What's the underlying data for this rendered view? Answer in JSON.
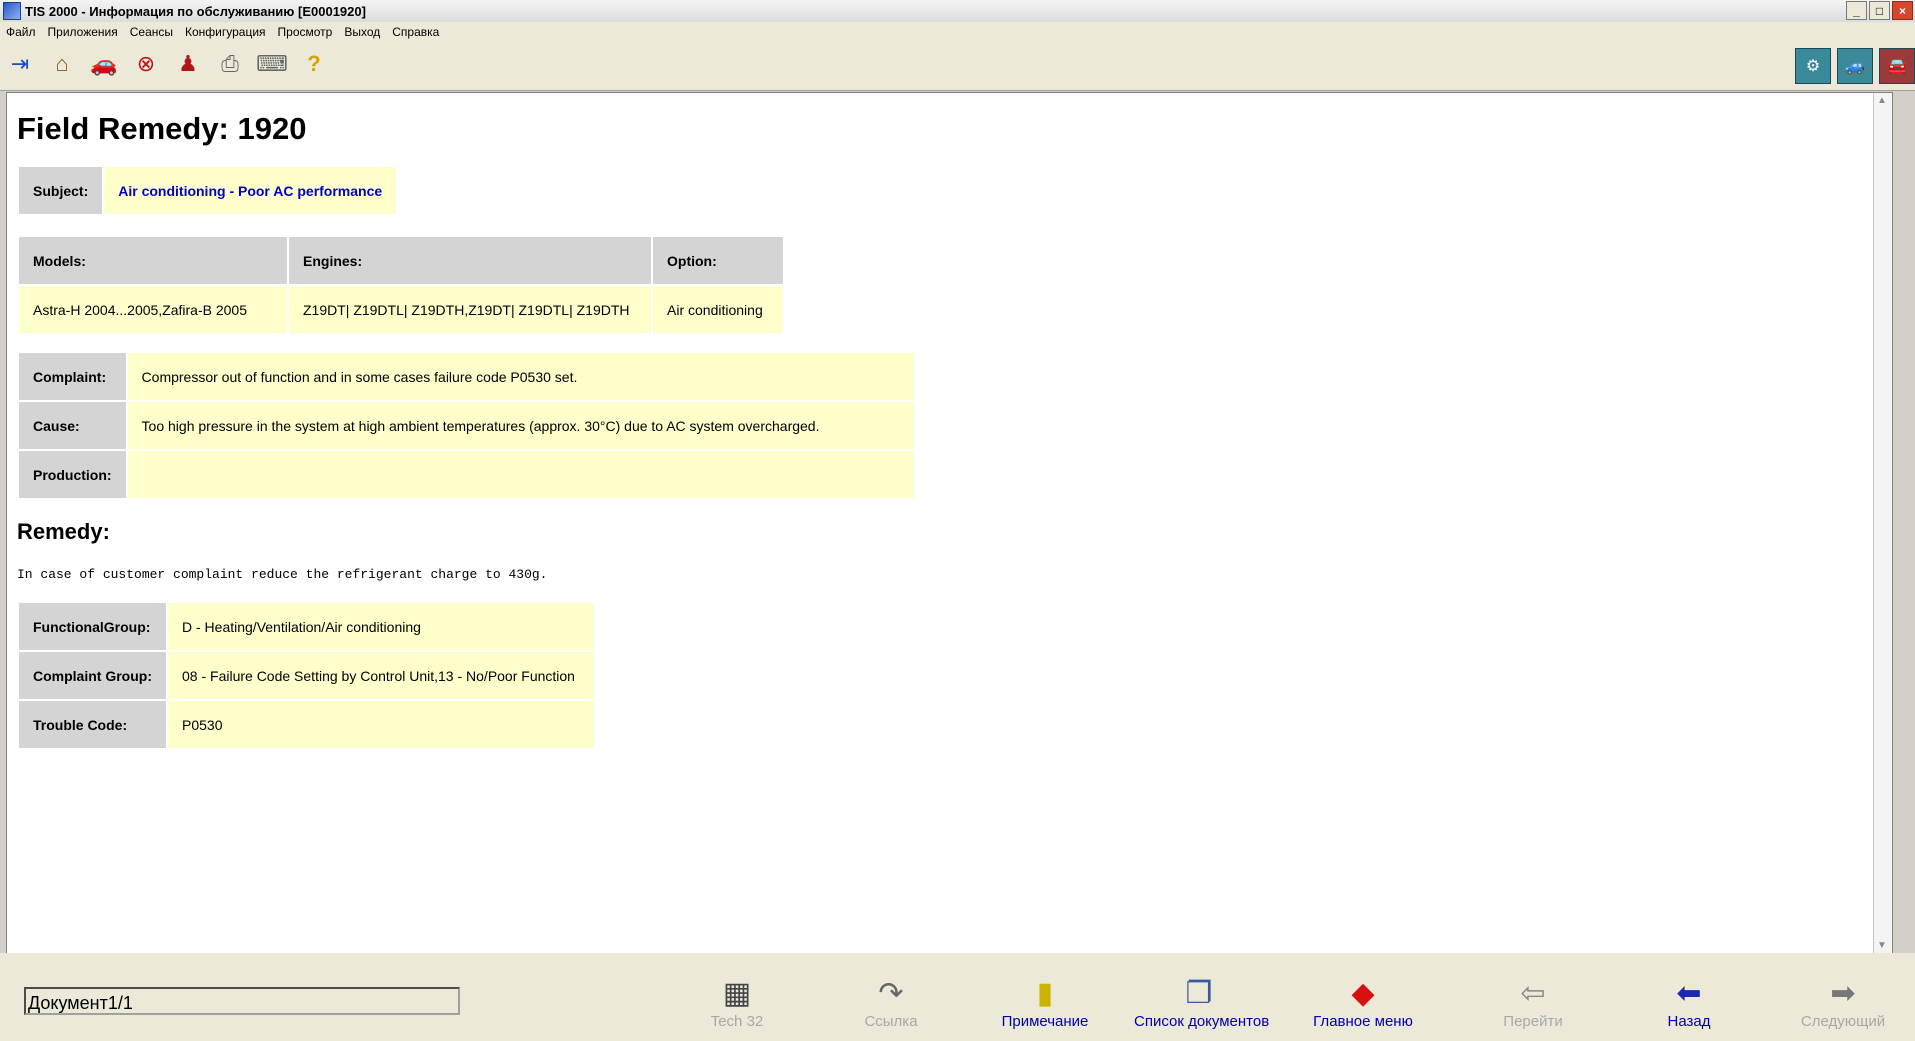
{
  "window": {
    "title": "TIS 2000 - Информация по обслуживанию [E0001920]"
  },
  "menu": [
    "Файл",
    "Приложения",
    "Сеансы",
    "Конфигурация",
    "Просмотр",
    "Выход",
    "Справка"
  ],
  "toolbar_icons": [
    "exit-icon",
    "home-icon",
    "vehicle-icon",
    "stop-icon",
    "person-icon",
    "print-icon",
    "keyboard-icon",
    "help-icon"
  ],
  "toolbar_right_icons": [
    "tools-icon",
    "car-diagnostics-icon",
    "car-service-icon"
  ],
  "page": {
    "title": "Field Remedy: 1920",
    "subject_label": "Subject:",
    "subject_value": "Air conditioning - Poor AC performance",
    "models_label": "Models:",
    "engines_label": "Engines:",
    "option_label": "Option:",
    "models_value": "Astra-H 2004...2005,Zafira-B 2005",
    "engines_value": "Z19DT| Z19DTL| Z19DTH,Z19DT| Z19DTL| Z19DTH",
    "option_value": "Air conditioning",
    "complaint_label": "Complaint:",
    "complaint_value": "Compressor out of function and in some cases failure code P0530 set.",
    "cause_label": "Cause:",
    "cause_value": "Too high pressure in the system at high ambient temperatures (approx. 30°C) due to AC system overcharged.",
    "production_label": "Production:",
    "production_value": "",
    "remedy_heading": "Remedy:",
    "remedy_text": "In case of customer complaint reduce the refrigerant charge to 430g.",
    "functional_group_label": "FunctionalGroup:",
    "functional_group_value": "D - Heating/Ventilation/Air conditioning",
    "complaint_group_label": "Complaint Group:",
    "complaint_group_value": "08 - Failure Code Setting by Control Unit,13 - No/Poor Function",
    "trouble_code_label": "Trouble Code:",
    "trouble_code_value": "P0530"
  },
  "bottom": {
    "document_field": "Документ1/1",
    "buttons": {
      "tech32": "Tech 32",
      "link": "Ссылка",
      "note": "Примечание",
      "doclist": "Список документов",
      "mainmenu": "Главное меню",
      "goto": "Перейти",
      "back": "Назад",
      "next": "Следующий"
    }
  }
}
